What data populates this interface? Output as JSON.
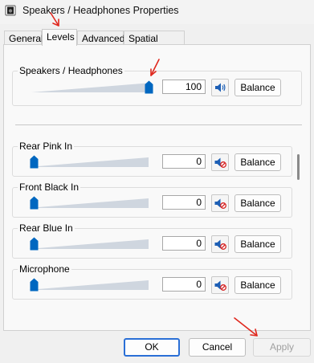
{
  "window": {
    "title": "Speakers / Headphones Properties"
  },
  "tabs": [
    {
      "label": "General",
      "active": false
    },
    {
      "label": "Levels",
      "active": true
    },
    {
      "label": "Advanced",
      "active": false
    },
    {
      "label": "Spatial sound",
      "active": false
    }
  ],
  "main": {
    "label": "Speakers / Headphones",
    "level": 100,
    "value": "100",
    "muted": false,
    "balance_label": "Balance"
  },
  "inputs": [
    {
      "label": "Rear Pink In",
      "level": 0,
      "value": "0",
      "muted": true,
      "balance_label": "Balance"
    },
    {
      "label": "Front Black In",
      "level": 0,
      "value": "0",
      "muted": true,
      "balance_label": "Balance"
    },
    {
      "label": "Rear Blue In",
      "level": 0,
      "value": "0",
      "muted": true,
      "balance_label": "Balance"
    },
    {
      "label": "Microphone",
      "level": 0,
      "value": "0",
      "muted": true,
      "balance_label": "Balance"
    }
  ],
  "footer": {
    "ok_label": "OK",
    "cancel_label": "Cancel",
    "apply_label": "Apply"
  },
  "colors": {
    "accent": "#0067c0",
    "annotation": "#e0281e"
  }
}
